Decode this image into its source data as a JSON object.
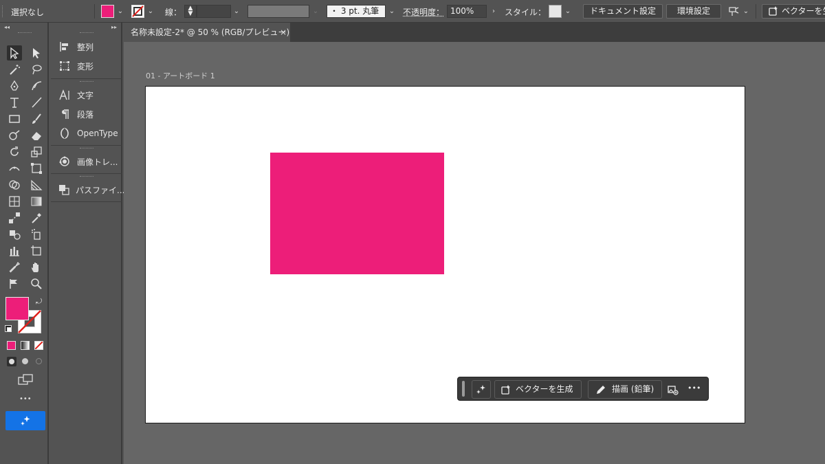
{
  "control_bar": {
    "selection_status": "選択なし",
    "stroke_label": "線：",
    "brush_value": "・ 3 pt. 丸筆",
    "opacity_label": "不透明度：",
    "opacity_value": "100%",
    "style_label": "スタイル：",
    "doc_settings_button": "ドキュメント設定",
    "preferences_button": "環境設定",
    "generate_vector_button": "ベクターを生"
  },
  "colors": {
    "fill": "#ed1e79",
    "canvas_bg": "#666666",
    "ai_button": "#1473e6"
  },
  "panels": {
    "items": [
      {
        "icon": "align-icon",
        "label": "整列"
      },
      {
        "icon": "transform-icon",
        "label": "変形"
      },
      {
        "icon": "character-icon",
        "label": "文字"
      },
      {
        "icon": "paragraph-icon",
        "label": "段落"
      },
      {
        "icon": "opentype-icon",
        "label": "OpenType"
      },
      {
        "icon": "image-trace-icon",
        "label": "画像トレ..."
      },
      {
        "icon": "pathfinder-icon",
        "label": "パスファイ..."
      }
    ]
  },
  "document": {
    "tab_title": "名称未設定-2* @ 50 % (RGB/プレビュー)",
    "tab_close": "×",
    "artboard_label": "01 - アートボード 1"
  },
  "taskbar": {
    "generate_vector": "ベクターを生成",
    "draw_pencil": "描画 (鉛筆)",
    "more": "•••"
  },
  "toolbar": {
    "more_tools": "•••"
  }
}
